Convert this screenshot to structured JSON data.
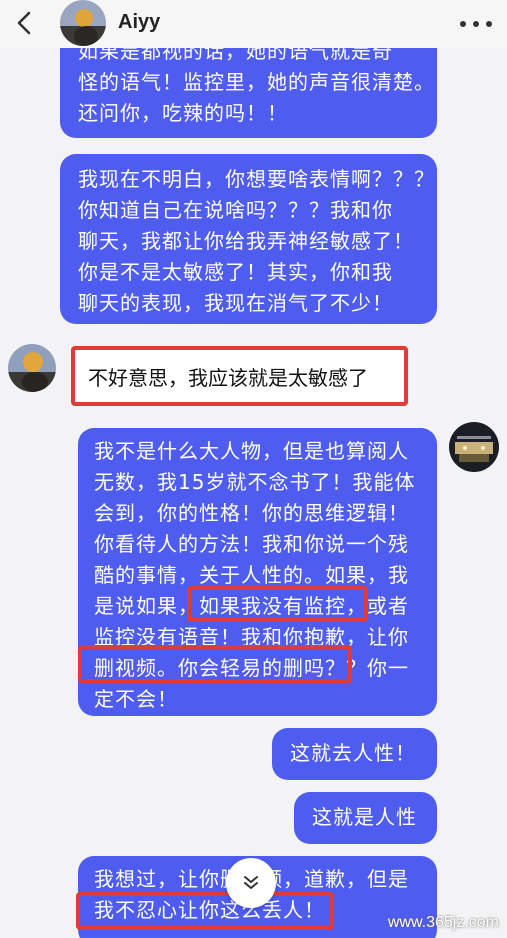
{
  "header": {
    "name": "Aiyy"
  },
  "messages": [
    {
      "side": "right",
      "lines": [
        "如果是都视的话，她的语气就是奇",
        "怪的语气！监控里，她的声音很清楚。",
        "还问你，吃辣的吗！！"
      ]
    },
    {
      "side": "right",
      "lines": [
        "我现在不明白，你想要啥表情啊？？？",
        "你知道自己在说啥吗？？？我和你",
        "聊天，我都让你给我弄神经敏感了！",
        "你是不是太敏感了！其实，你和我",
        "聊天的表现，我现在消气了不少！"
      ]
    },
    {
      "side": "left",
      "lines": [
        "不好意思，我应该就是太敏感了"
      ]
    },
    {
      "side": "right",
      "lines": [
        "我不是什么大人物，但是也算阅人",
        "无数，我15岁就不念书了！我能体",
        "会到，你的性格！你的思维逻辑！",
        "你看待人的方法！我和你说一个残",
        "酷的事情，关于人性的。如果，我",
        "是说如果，如果我没有监控，或者",
        "监控没有语音！我和你抱歉，让你",
        "删视频。你会轻易的删吗？？你一",
        "定不会！"
      ]
    },
    {
      "side": "right",
      "lines": [
        "这就去人性！"
      ]
    },
    {
      "side": "right",
      "lines": [
        "这就是人性"
      ]
    },
    {
      "side": "right",
      "lines": [
        "我想过，让你删视频，道歉，但是",
        "我不忍心让你这么丢人！"
      ]
    }
  ],
  "watermark": "www.365jz.com",
  "colors": {
    "bubble_blue": "#4f5cf0",
    "highlight_red": "#e03b3b",
    "background": "#f3f3f5"
  },
  "icons": {
    "back": "chevron-left-icon",
    "more": "more-dots-icon",
    "scroll": "double-chevron-down-icon"
  }
}
